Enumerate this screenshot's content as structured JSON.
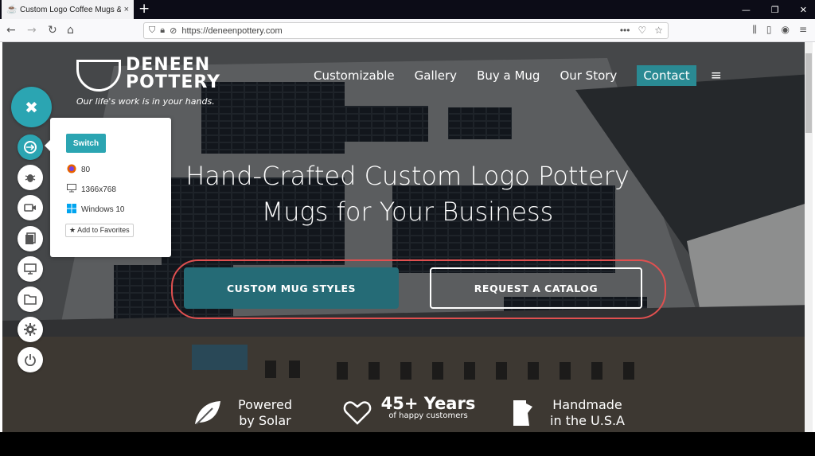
{
  "browser": {
    "tab_title": "Custom Logo Coffee Mugs & H",
    "tab_close": "×",
    "new_tab": "+",
    "url": "https://deneenpottery.com",
    "window_min": "—",
    "window_max": "❐",
    "window_close": "✕"
  },
  "site": {
    "brand_line1": "DENEEN",
    "brand_line2": "POTTERY",
    "tagline": "Our life's work is in your hands.",
    "nav": [
      "Customizable",
      "Gallery",
      "Buy a Mug",
      "Our Story",
      "Contact"
    ],
    "hero_line1": "Hand-Crafted Custom Logo Pottery",
    "hero_line2": "Mugs for Your Business",
    "cta_primary": "CUSTOM MUG STYLES",
    "cta_secondary": "REQUEST A CATALOG",
    "features": [
      {
        "line1": "Powered",
        "line2": "by Solar"
      },
      {
        "line1": "45+ Years",
        "line2": "of happy customers"
      },
      {
        "line1": "Handmade",
        "line2": "in the U.S.A"
      }
    ],
    "sign_text": "DENEEN POTTERY"
  },
  "toolbar": {
    "switch_label": "Switch",
    "browser_version": "80",
    "resolution": "1366x768",
    "os": "Windows 10",
    "favorites_label": "Add to Favorites"
  }
}
